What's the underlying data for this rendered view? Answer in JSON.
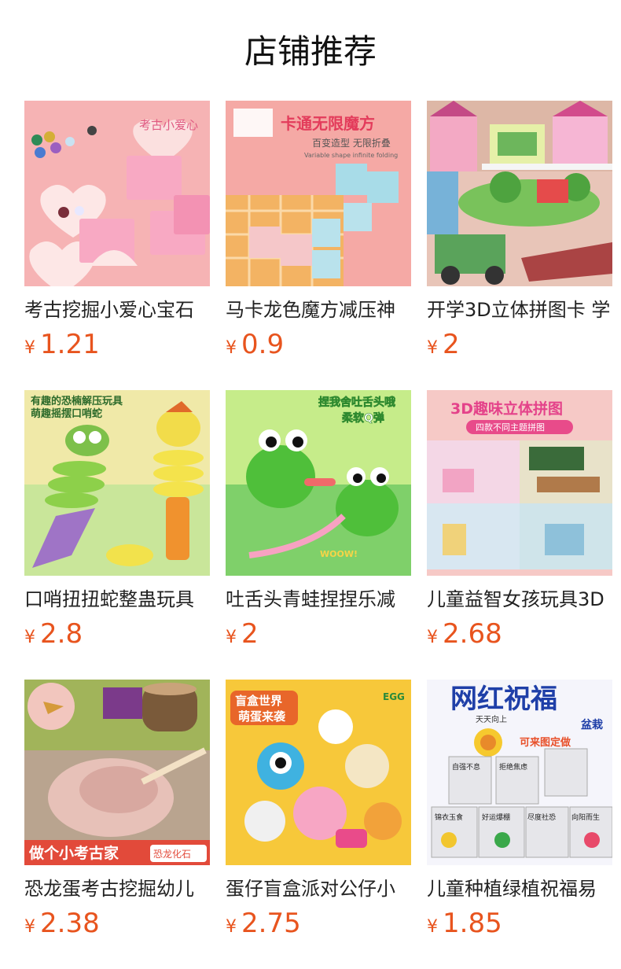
{
  "page": {
    "title": "店铺推荐"
  },
  "products": [
    {
      "name": "考古挖掘小爱心宝石",
      "price": "1.21",
      "image_text": [
        "考古小爱心"
      ],
      "thumb_icon": "heart-gems-box-image"
    },
    {
      "name": "马卡龙色魔方减压神",
      "price": "0.9",
      "image_text": [
        "卡通无限魔方",
        "百变造型 无限折叠",
        "Variable shape infinite folding"
      ],
      "thumb_icon": "infinity-cube-image"
    },
    {
      "name": "开学3D立体拼图卡 学",
      "price": "2",
      "image_text": [],
      "thumb_icon": "3d-puzzle-castle-image"
    },
    {
      "name": "口哨扭扭蛇整蛊玩具",
      "price": "2.8",
      "image_text": [
        "有趣的恐楠解压玩具",
        "萌趣摇摆口哨蛇"
      ],
      "thumb_icon": "whistle-snake-image"
    },
    {
      "name": "吐舌头青蛙捏捏乐减",
      "price": "2",
      "image_text": [
        "捏我舍吐舌头哦",
        "柔软Q弹",
        "WOOW!"
      ],
      "thumb_icon": "frog-squeeze-image"
    },
    {
      "name": "儿童益智女孩玩具3D",
      "price": "2.68",
      "image_text": [
        "3D趣味立体拼图",
        "四款不同主题拼图"
      ],
      "thumb_icon": "3d-house-puzzle-image"
    },
    {
      "name": "恐龙蛋考古挖掘幼儿",
      "price": "2.38",
      "image_text": [
        "做个小考古家",
        "恐龙化石"
      ],
      "thumb_icon": "dino-egg-dig-image"
    },
    {
      "name": "蛋仔盲盒派对公仔小",
      "price": "2.75",
      "image_text": [
        "盲盒世界",
        "萌蛋来袭",
        "EGG"
      ],
      "thumb_icon": "egg-party-blindbox-image"
    },
    {
      "name": "儿童种植绿植祝福易",
      "price": "1.85",
      "image_text": [
        "网红祝福",
        "盆栽",
        "天天向上",
        "可来图定做",
        "自强不息",
        "拒绝焦虑",
        "锦衣玉食",
        "好运爆棚",
        "尽度社恐",
        "向阳而生"
      ],
      "thumb_icon": "plant-cans-image"
    }
  ],
  "currency_symbol": "¥",
  "colors": {
    "price": "#e8541e"
  }
}
